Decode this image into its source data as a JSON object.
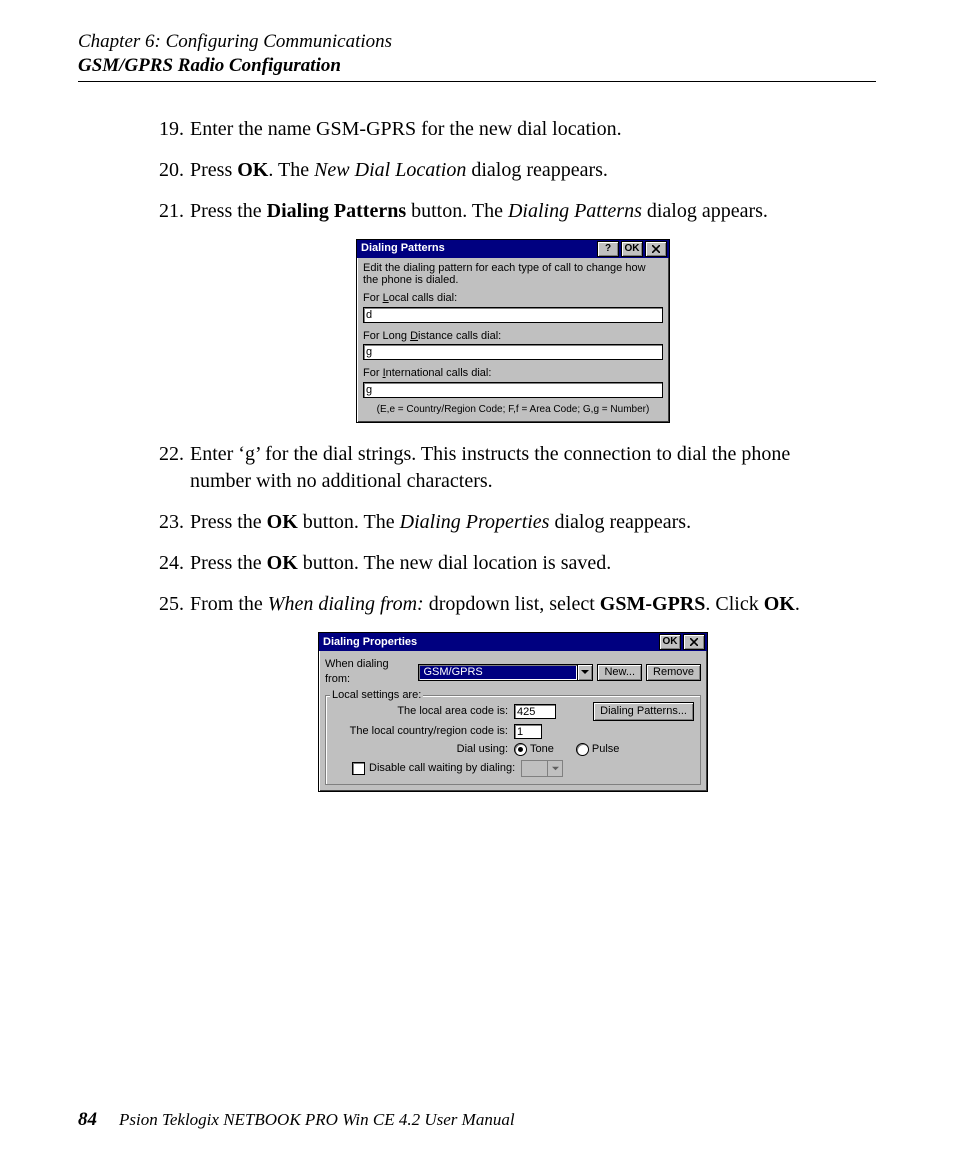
{
  "header": {
    "chapter": "Chapter 6:  Configuring Communications",
    "section": "GSM/GPRS Radio Configuration"
  },
  "steps": [
    {
      "num": "19.",
      "html": "Enter the name GSM-GPRS for the new dial location."
    },
    {
      "num": "20.",
      "html": "Press <strong>OK</strong>. The <em>New Dial Location</em> dialog reappears."
    },
    {
      "num": "21.",
      "html": "Press the <strong>Dialing Patterns</strong> button. The <em>Dialing Patterns</em> dialog appears."
    },
    {
      "num": "22.",
      "html": "Enter ‘g’ for the dial strings. This instructs the connection to dial the phone number with no additional characters."
    },
    {
      "num": "23.",
      "html": "Press the <strong>OK</strong> button. The <em>Dialing Properties</em> dialog reappears."
    },
    {
      "num": "24.",
      "html": "Press the <strong>OK</strong> button. The new dial location is saved."
    },
    {
      "num": "25.",
      "html": "From the <em>When dialing from:</em> dropdown list, select <strong>GSM-GPRS</strong>. Click <strong>OK</strong>."
    }
  ],
  "dialog1": {
    "title": "Dialing Patterns",
    "help_btn": "?",
    "ok_btn": "OK",
    "instruction": "Edit the dialing pattern for each type of call to change how the phone is dialed.",
    "local_label_pre": "For ",
    "local_label_u": "L",
    "local_label_post": "ocal calls dial:",
    "local_value": "d",
    "long_label_pre": "For Long ",
    "long_label_u": "D",
    "long_label_post": "istance calls dial:",
    "long_value": "g",
    "intl_label_pre": "For ",
    "intl_label_u": "I",
    "intl_label_post": "nternational calls dial:",
    "intl_value": "g",
    "legend": "(E,e = Country/Region Code; F,f = Area Code; G,g = Number)"
  },
  "dialog2": {
    "title": "Dialing Properties",
    "ok_btn": "OK",
    "when_label": "When dialing from:",
    "when_value": "GSM/GPRS",
    "new_btn": "New...",
    "remove_btn": "Remove",
    "group_title": "Local settings are:",
    "area_label": "The local area code is:",
    "area_value": "425",
    "patterns_btn": "Dialing Patterns...",
    "country_label": "The local country/region code is:",
    "country_value": "1",
    "dial_using_label": "Dial using:",
    "tone_label": "Tone",
    "pulse_label": "Pulse",
    "disable_cw_label": "Disable call waiting by dialing:"
  },
  "footer": {
    "page_num": "84",
    "book": "Psion Teklogix NETBOOK PRO Win CE 4.2 User Manual"
  }
}
